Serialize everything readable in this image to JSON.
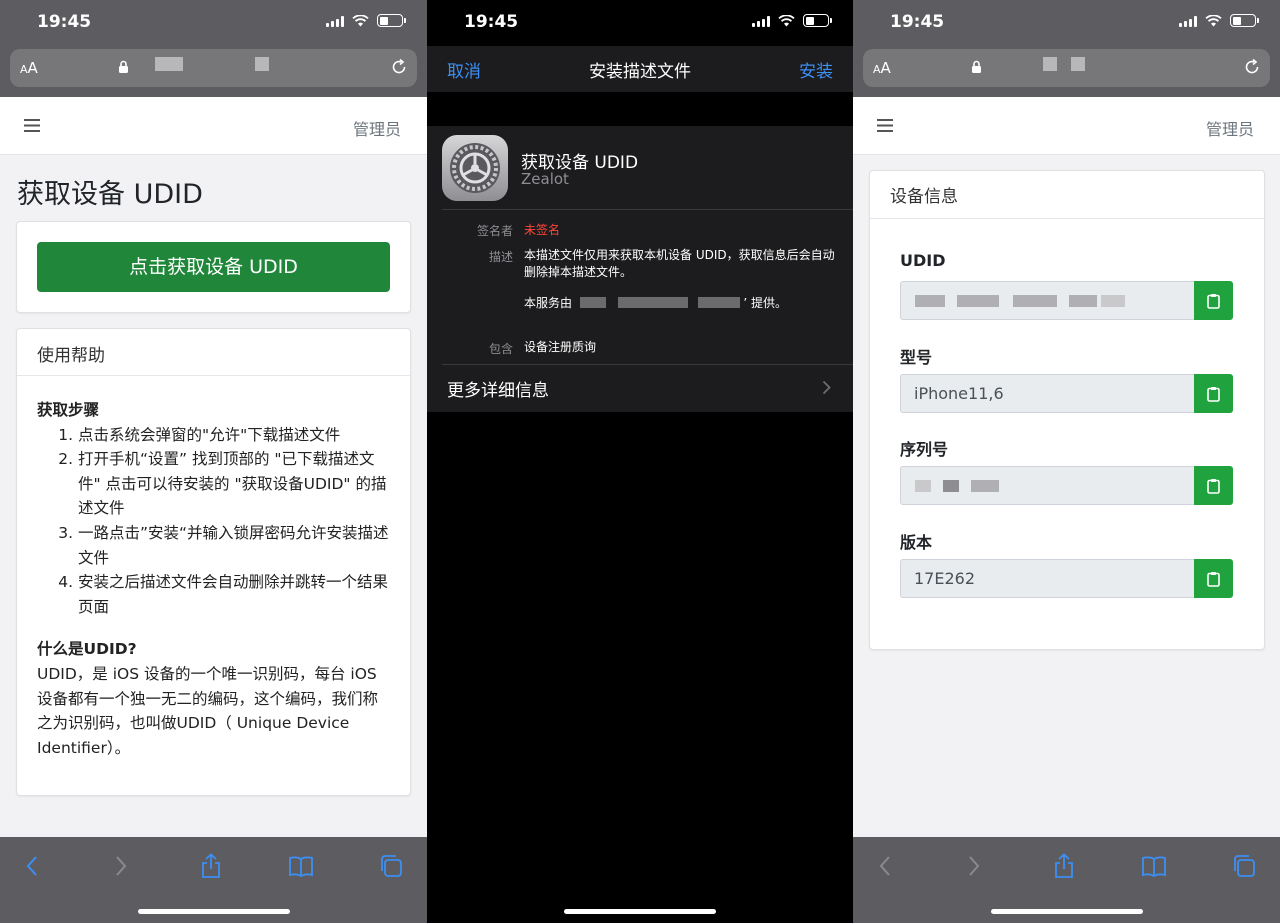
{
  "status_bar": {
    "time": "19:45"
  },
  "phone1": {
    "url_bar": {
      "text_size_label": "AA"
    },
    "navbar": {
      "admin_label": "管理员"
    },
    "page_title": "获取设备 UDID",
    "primary_button": "点击获取设备 UDID",
    "help_card": {
      "header": "使用帮助",
      "steps_title": "获取步骤",
      "steps": [
        "点击系统会弹窗的\"允许\"下载描述文件",
        "打开手机“设置” 找到顶部的 \"已下载描述文件\" 点击可以待安装的 \"获取设备UDID\" 的描述文件",
        "一路点击”安装“并输入锁屏密码允许安装描述文件",
        "安装之后描述文件会自动删除并跳转一个结果页面"
      ],
      "what_title": "什么是UDID?",
      "what_text": "UDID，是 iOS 设备的一个唯一识别码，每台 iOS 设备都有一个独一无二的编码，这个编码，我们称之为识别码，也叫做UDID（ Unique Device Identifier）。"
    },
    "toolbar": [
      "back-icon",
      "forward-icon",
      "share-icon",
      "bookmarks-icon",
      "tabs-icon"
    ]
  },
  "phone2": {
    "nav": {
      "cancel": "取消",
      "title": "安装描述文件",
      "install": "安装"
    },
    "profile": {
      "name": "获取设备 UDID",
      "org": "Zealot"
    },
    "rows": {
      "signer_label": "签名者",
      "signer_value": "未签名",
      "desc_label": "描述",
      "desc_value": "本描述文件仅用来获取本机设备 UDID，获取信息后会自动删除掉本描述文件。",
      "provider_prefix": "本服务由",
      "provider_suffix": "’ 提供。",
      "contains_label": "包含",
      "contains_value": "设备注册质询"
    },
    "more_info": "更多详细信息"
  },
  "phone3": {
    "url_bar": {
      "text_size_label": "AA"
    },
    "navbar": {
      "admin_label": "管理员"
    },
    "card_header": "设备信息",
    "fields": [
      {
        "label": "UDID",
        "value": ""
      },
      {
        "label": "型号",
        "value": "iPhone11,6"
      },
      {
        "label": "序列号",
        "value": ""
      },
      {
        "label": "版本",
        "value": "17E262"
      }
    ]
  },
  "colors": {
    "primary_green": "#20873a",
    "copy_green": "#20a33f",
    "ios_blue": "#3b8ff5",
    "unsigned_red": "#ff453a"
  }
}
